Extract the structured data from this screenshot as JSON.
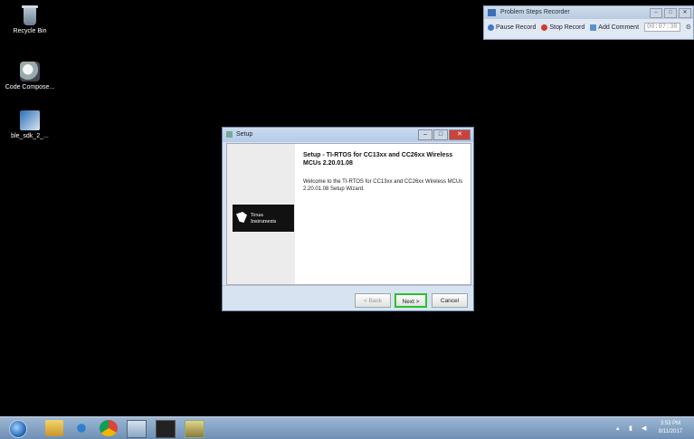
{
  "desktop": {
    "icons": [
      {
        "label": "Recycle Bin",
        "icon": "recycle-bin-icon"
      },
      {
        "label": "Code Compose...",
        "icon": "code-composer-icon"
      },
      {
        "label": "ble_sdk_2_...",
        "icon": "ble-sdk-icon"
      }
    ]
  },
  "psr": {
    "title": "Problem Steps Recorder",
    "pause": "Pause Record",
    "stop": "Stop Record",
    "comment": "Add Comment",
    "timer": "00:07:30"
  },
  "dialog": {
    "title": "Setup",
    "heading": "Setup - TI-RTOS for CC13xx and CC26xx Wireless MCUs 2.20.01.08",
    "welcome": "Welcome to the TI-RTOS for CC13xx and CC26xx Wireless MCUs 2.20.01.08 Setup Wizard.",
    "logo_line1": "Texas",
    "logo_line2": "Instruments",
    "back": "< Back",
    "next": "Next >",
    "cancel": "Cancel"
  },
  "taskbar": {
    "time": "3:53 PM",
    "date": "8/11/2017"
  },
  "colors": {
    "highlight": "#2ac22a",
    "taskbar": "#8aa8c8"
  }
}
